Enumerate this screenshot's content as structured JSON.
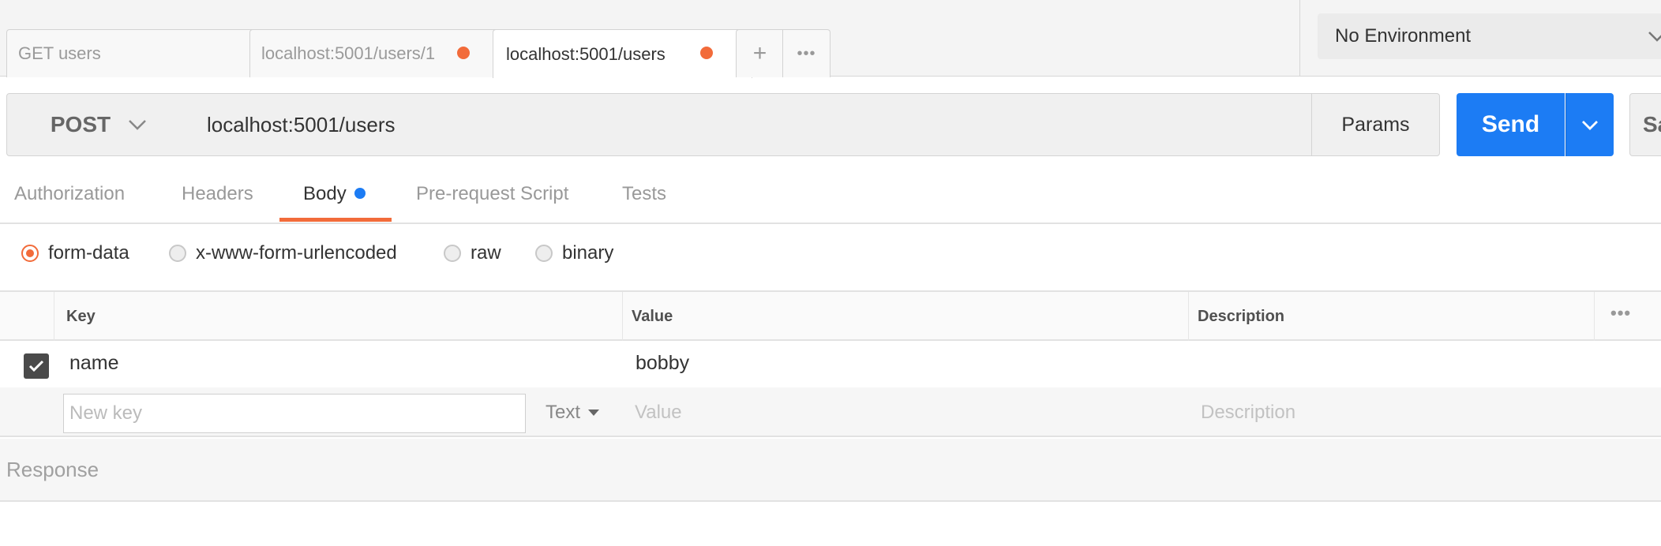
{
  "tabs": [
    {
      "label": "GET users",
      "unsaved": false,
      "active": false
    },
    {
      "label": "localhost:5001/users/1",
      "unsaved": true,
      "active": false
    },
    {
      "label": "localhost:5001/users",
      "unsaved": true,
      "active": true
    }
  ],
  "tab_actions": {
    "new_tab_icon": "+",
    "more_icon": "•••"
  },
  "environment": {
    "selected": "No Environment"
  },
  "request": {
    "method": "POST",
    "url": "localhost:5001/users",
    "params_label": "Params",
    "send_label": "Send",
    "save_label": "Sa"
  },
  "subtabs": [
    {
      "label": "Authorization",
      "active": false
    },
    {
      "label": "Headers",
      "active": false
    },
    {
      "label": "Body",
      "active": true,
      "indicator": true
    },
    {
      "label": "Pre-request Script",
      "active": false
    },
    {
      "label": "Tests",
      "active": false
    }
  ],
  "body_types": [
    {
      "label": "form-data",
      "selected": true
    },
    {
      "label": "x-www-form-urlencoded",
      "selected": false
    },
    {
      "label": "raw",
      "selected": false
    },
    {
      "label": "binary",
      "selected": false
    }
  ],
  "table": {
    "headers": {
      "key": "Key",
      "value": "Value",
      "description": "Description"
    },
    "more_icon": "•••",
    "rows": [
      {
        "checked": true,
        "key": "name",
        "value": "bobby",
        "description": ""
      }
    ],
    "new_row": {
      "key_placeholder": "New key",
      "type": "Text",
      "value_placeholder": "Value",
      "description_placeholder": "Description"
    }
  },
  "response": {
    "title": "Response"
  },
  "colors": {
    "accent": "#f26b3a",
    "primary": "#1c7cf4"
  }
}
